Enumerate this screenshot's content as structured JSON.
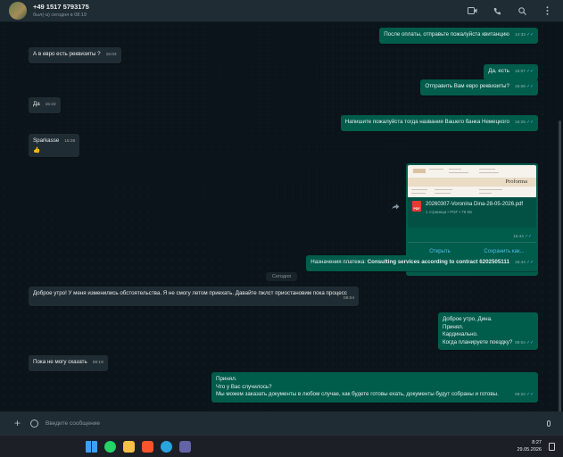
{
  "header": {
    "contact_name": "+49 1517 5793175",
    "contact_status": "был(-а) сегодня в 08:19"
  },
  "messages": [
    {
      "dir": "out",
      "text": "После оплаты, отправьте пожалуйста квитанцию",
      "time": "14:33",
      "ticks": "✓✓"
    },
    {
      "dir": "in",
      "text": "А в евро есть реквизиты ?",
      "time": "15:03"
    },
    {
      "dir": "out",
      "text": "Да, есть",
      "time": "15:07",
      "ticks": "✓✓"
    },
    {
      "dir": "out",
      "text": "Отправить Вам евро реквизиты?",
      "time": "15:08",
      "ticks": "✓✓"
    },
    {
      "dir": "in",
      "text": "Да",
      "time": "15:22"
    },
    {
      "dir": "out",
      "text": "Напишите пожалуйста тогда названия Вашего банка Немецкого",
      "time": "15:25",
      "ticks": "✓✓"
    },
    {
      "dir": "in",
      "text": "Sparkasse",
      "time": "15:36",
      "reaction": "👍"
    },
    {
      "dir": "out",
      "label": "Назначения платежа: ",
      "bold": "Consulting services according to contract 6202505111",
      "time": "15:44",
      "ticks": "✓✓"
    },
    {
      "dir": "in",
      "text": "Доброе утро! У меня изменились обстоятельства. Я не смогу летом приехать. Давайте пжлст приостановим пока процесс",
      "time": "08:04"
    },
    {
      "dir": "out",
      "lines": [
        "Доброе утро, Дина.",
        "Принял.",
        "Кардинально.",
        "Когда планируете поездку?"
      ],
      "time": "08:04",
      "ticks": "✓✓"
    },
    {
      "dir": "in",
      "text": "Пока не могу сказать",
      "time": "08:19"
    },
    {
      "dir": "out",
      "lines": [
        "Принял.",
        "Что у Вас случилось?",
        "Мы можем заказать документы в любом случае, как будете готовы ехать, документы будут собраны и готовы."
      ],
      "time": "08:22",
      "ticks": "✓✓"
    }
  ],
  "document": {
    "preview_title": "Proforma",
    "file_name": "20260307-Voronina Dina-28-05-2026.pdf",
    "file_info": "1 страница • PDF • 78 КБ",
    "badge": "PDF",
    "time": "15:44",
    "ticks": "✓✓",
    "open_label": "Открыть",
    "save_label": "Сохранить как..."
  },
  "date_divider": "Сегодня",
  "composer": {
    "placeholder": "Введите сообщение"
  },
  "taskbar": {
    "time": "8:27",
    "date": "29.05.2026"
  },
  "colors": {
    "incoming": "#202c33",
    "outgoing": "#005c4b",
    "background": "#0b141a",
    "accent": "#53bdeb"
  }
}
